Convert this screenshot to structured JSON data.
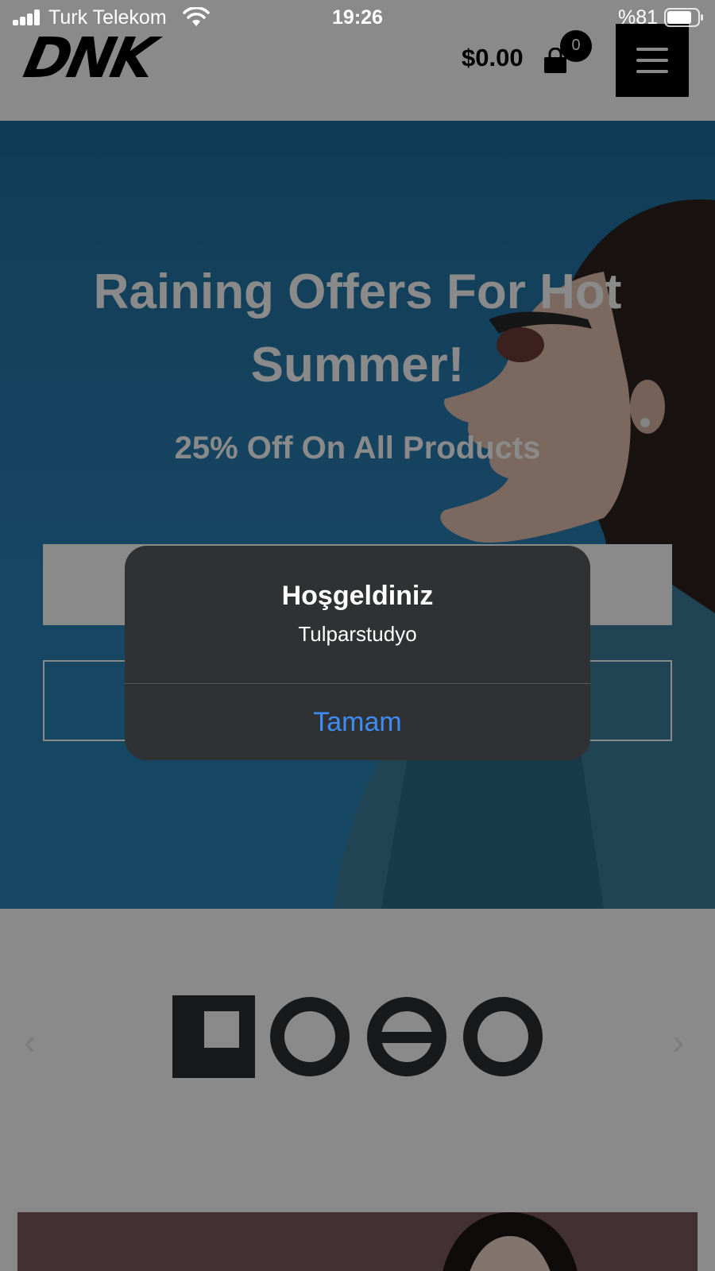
{
  "status_bar": {
    "carrier": "Turk Telekom",
    "time": "19:26",
    "battery": "%81"
  },
  "header": {
    "logo_text": "DNK",
    "cart_total": "$0.00",
    "cart_count": "0"
  },
  "hero": {
    "title": "Raining Offers For Hot Summer!",
    "subtitle": "25% Off On All Products"
  },
  "brand_slider": {
    "prev": "‹",
    "next": "›"
  },
  "alert": {
    "title": "Hoşgeldiniz",
    "message": "Tulparstudyo",
    "ok_label": "Tamam",
    "ok_color": "#3f8cf5"
  },
  "colors": {
    "header_bg": "#ffffff",
    "hero_blue": "#2a7fb3",
    "alert_bg": "#2f3133"
  }
}
